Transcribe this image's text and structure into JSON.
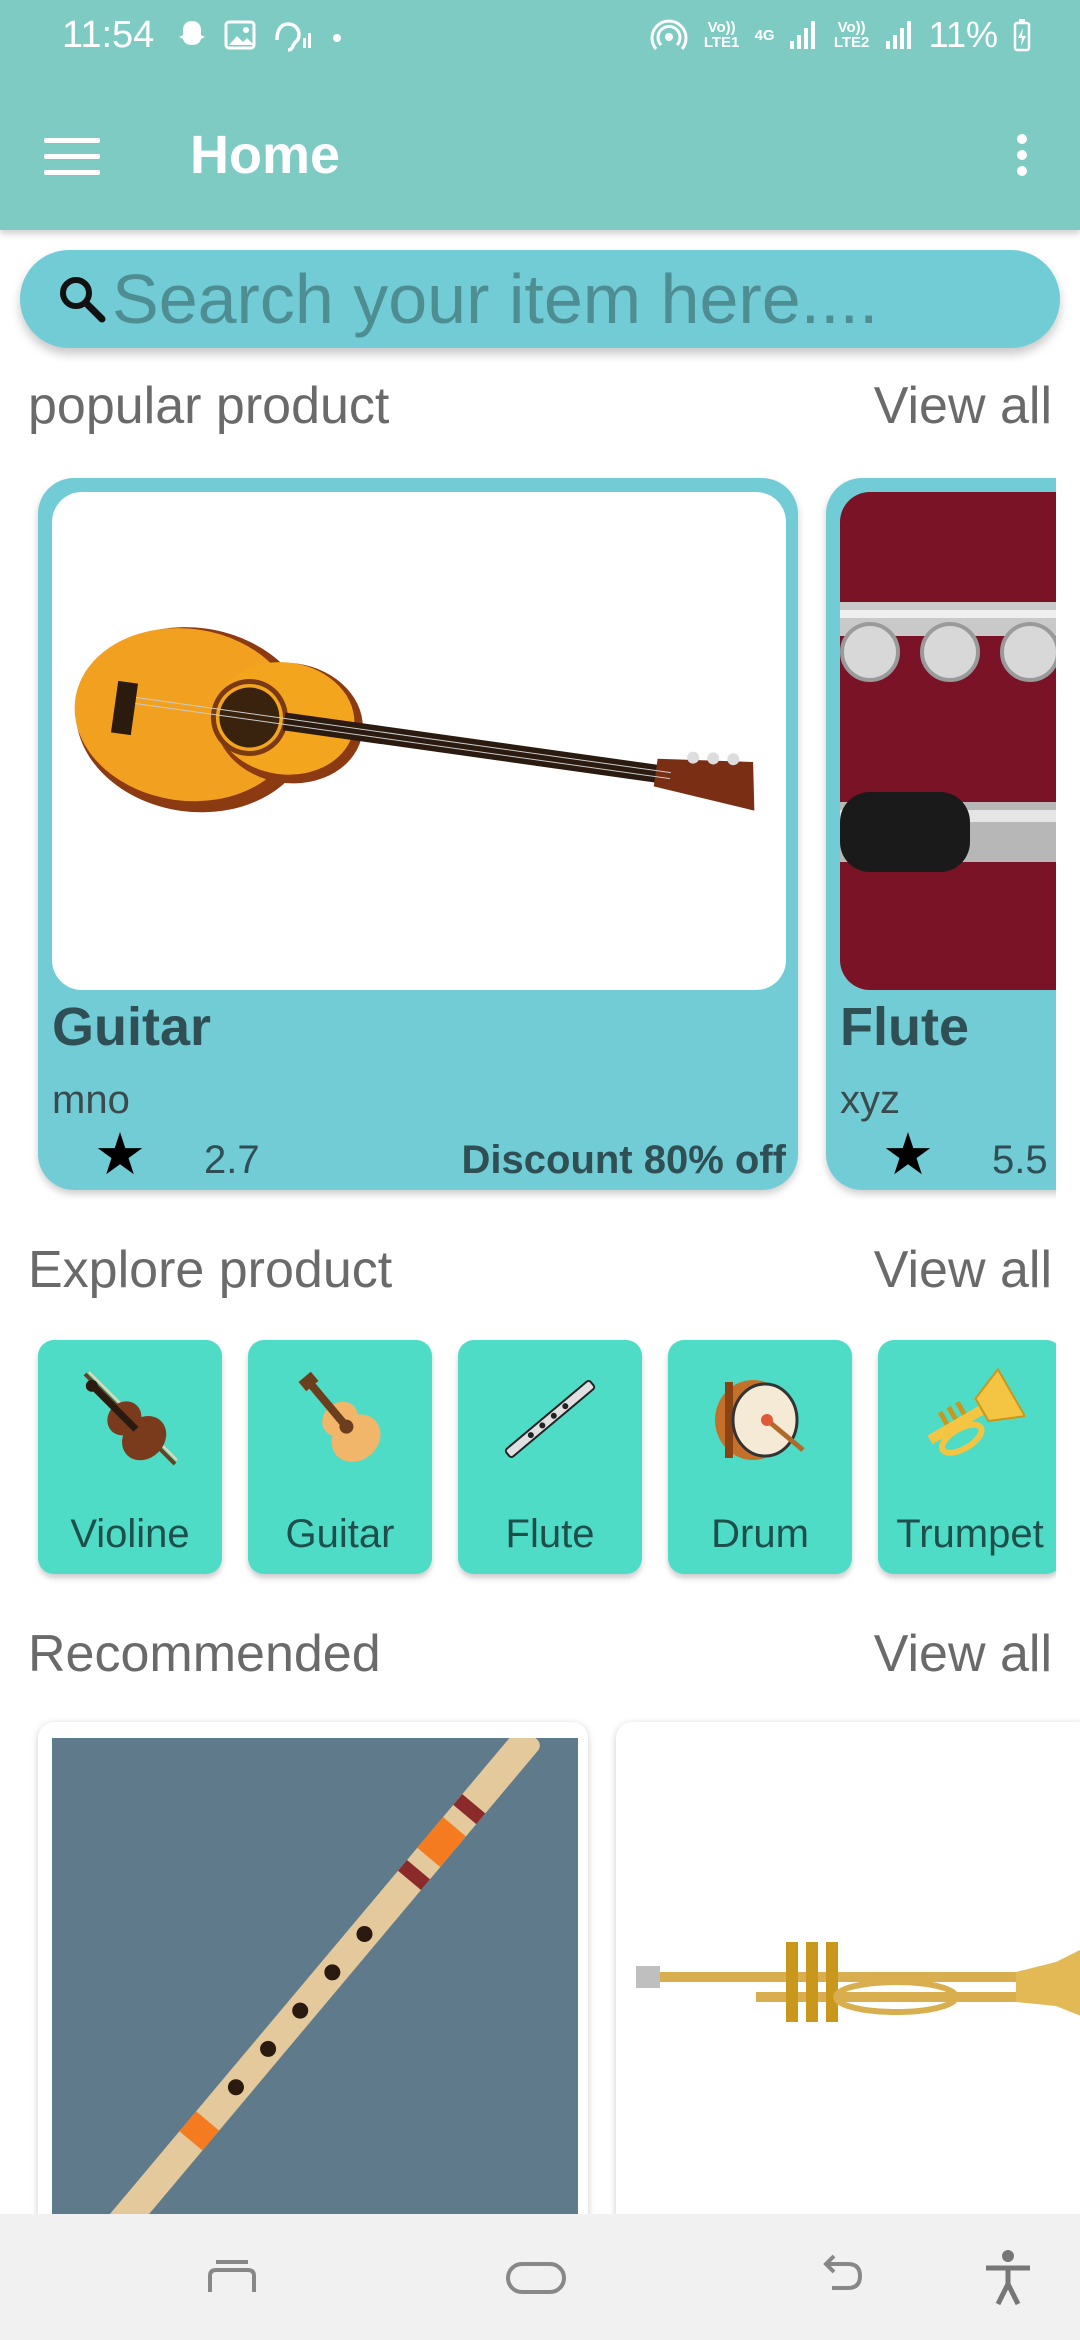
{
  "status": {
    "time": "11:54",
    "battery": "11%",
    "lte1": "Vo)) LTE1",
    "net": "4G",
    "lte2": "Vo)) LTE2"
  },
  "appbar": {
    "title": "Home"
  },
  "search": {
    "placeholder": "Search your item here...."
  },
  "popular": {
    "title": "popular product",
    "view_all": "View all",
    "items": [
      {
        "name": "Guitar",
        "brand": "mno",
        "rating": "2.7",
        "discount": "Discount 80% off"
      },
      {
        "name": "Flute",
        "brand": "xyz",
        "rating": "5.5",
        "discount": ""
      }
    ]
  },
  "explore": {
    "title": "Explore product",
    "view_all": "View all",
    "items": [
      {
        "label": "Violine",
        "icon": "violin-icon"
      },
      {
        "label": "Guitar",
        "icon": "guitar-icon"
      },
      {
        "label": "Flute",
        "icon": "flute-icon"
      },
      {
        "label": "Drum",
        "icon": "drum-icon"
      },
      {
        "label": "Trumpet",
        "icon": "trumpet-icon"
      }
    ]
  },
  "recommended": {
    "title": "Recommended",
    "view_all": "View all"
  },
  "colors": {
    "appbar": "#7ecbc3",
    "search": "#72ccd6",
    "card": "#72ccd6",
    "explore_card": "#4fdcc7"
  }
}
